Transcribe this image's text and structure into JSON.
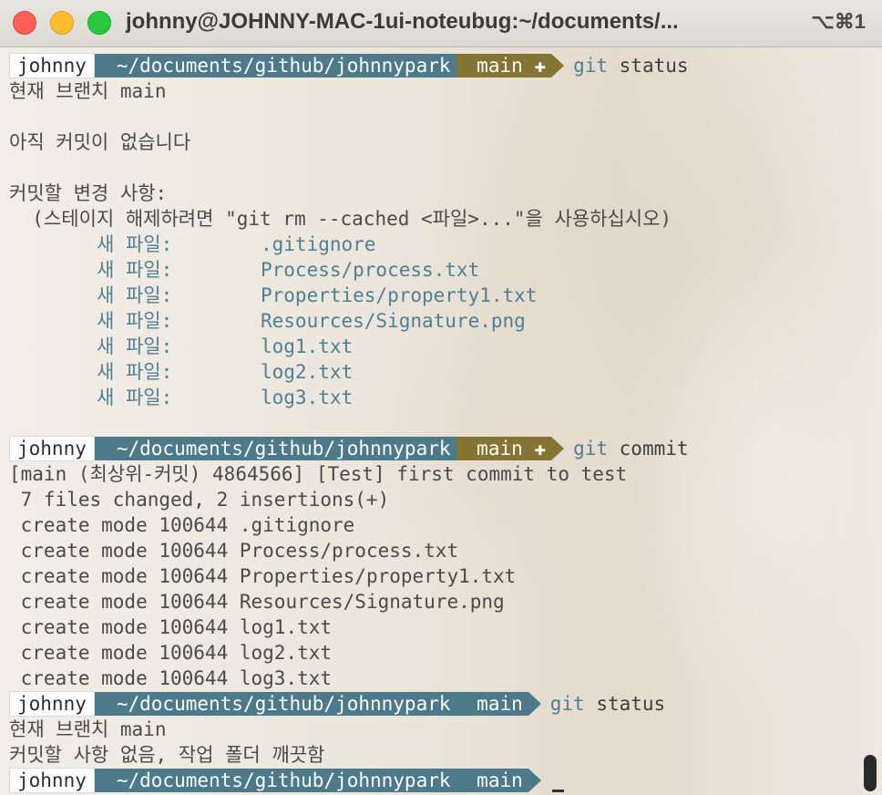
{
  "window": {
    "title": "johnny@JOHNNY-MAC-1ui-noteubug:~/documents/...",
    "shortcut": "⌥⌘1"
  },
  "prompts": [
    {
      "user": "johnny",
      "dir": "~/documents/github/johnnypark",
      "branch": "main",
      "dirty": "✚",
      "cmd": "git",
      "args": "status"
    },
    {
      "user": "johnny",
      "dir": "~/documents/github/johnnypark",
      "branch": "main",
      "dirty": "✚",
      "cmd": "git",
      "args": "commit"
    },
    {
      "user": "johnny",
      "dir": "~/documents/github/johnnypark",
      "branch": "main",
      "dirty": "",
      "cmd": "git",
      "args": "status"
    },
    {
      "user": "johnny",
      "dir": "~/documents/github/johnnypark",
      "branch": "main",
      "dirty": "",
      "cmd": "",
      "args": ""
    }
  ],
  "branch_icon": "",
  "status1": {
    "on_branch": "현재 브랜치 main",
    "no_commits": "아직 커밋이 없습니다",
    "changes_header": "커밋할 변경 사항:",
    "hint": "  (스테이지 해제하려면 \"git rm --cached <파일>...\"을 사용하십시오)",
    "new_file_label": "새 파일:",
    "files": [
      ".gitignore",
      "Process/process.txt",
      "Properties/property1.txt",
      "Resources/Signature.png",
      "log1.txt",
      "log2.txt",
      "log3.txt"
    ]
  },
  "commit": {
    "summary": "[main (최상위-커밋) 4864566] [Test] first commit to test",
    "stats": " 7 files changed, 2 insertions(+)",
    "create_prefix": " create mode 100644 ",
    "files": [
      ".gitignore",
      "Process/process.txt",
      "Properties/property1.txt",
      "Resources/Signature.png",
      "log1.txt",
      "log2.txt",
      "log3.txt"
    ]
  },
  "status2": {
    "on_branch": "현재 브랜치 main",
    "clean": "커밋할 사항 없음, 작업 폴더 깨끗함"
  }
}
